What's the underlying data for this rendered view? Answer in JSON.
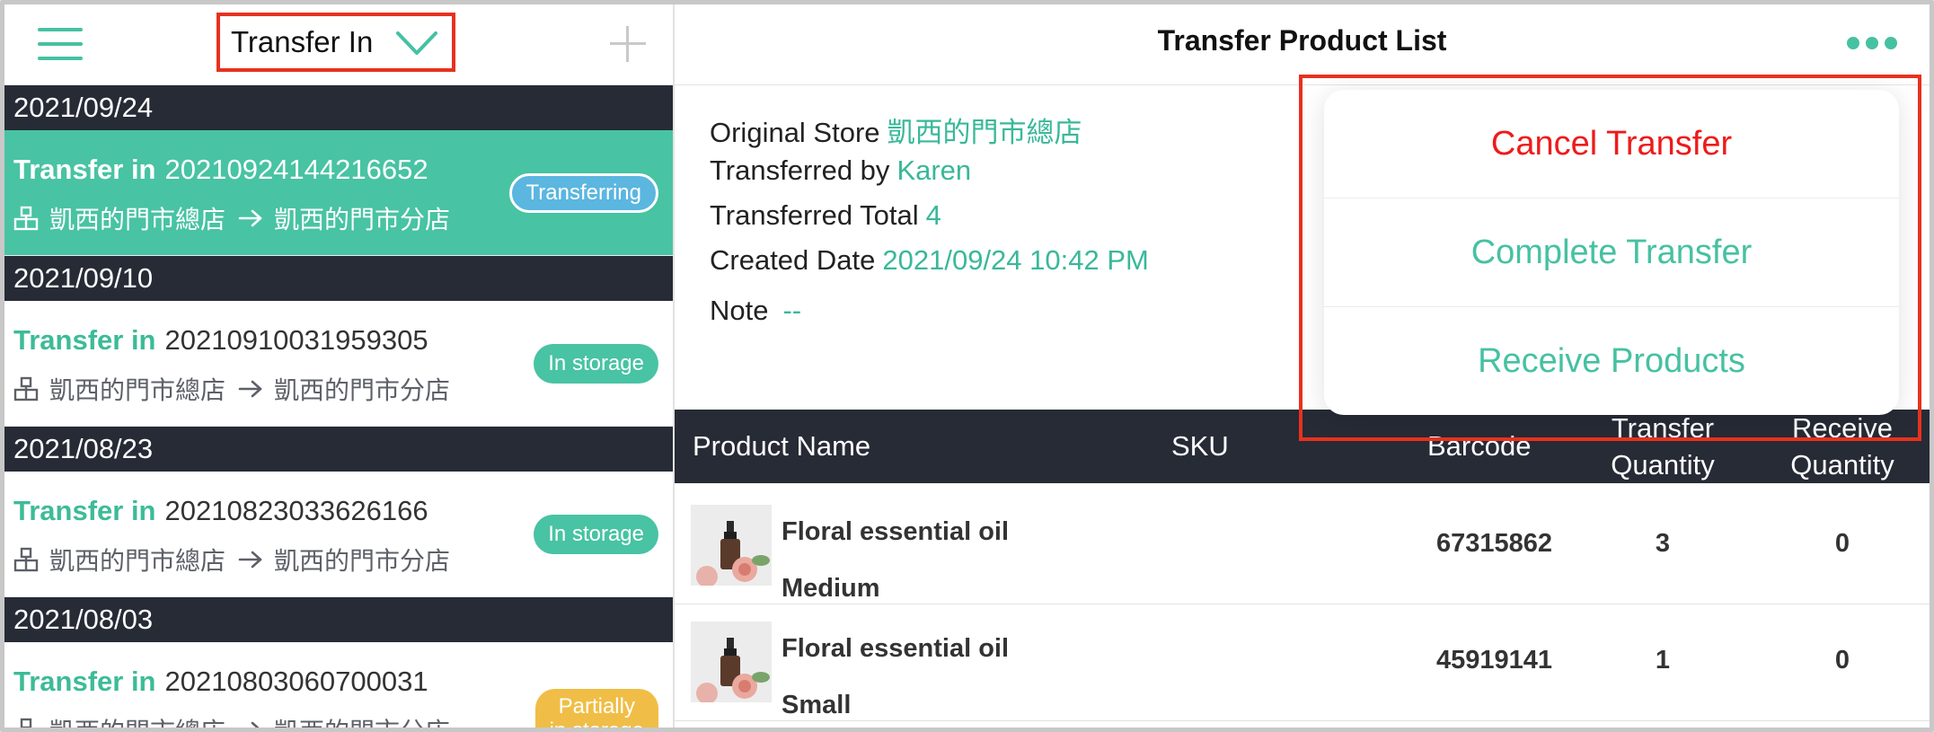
{
  "left": {
    "title": "Transfer In",
    "groups": [
      {
        "date": "2021/09/24",
        "items": [
          {
            "type_label": "Transfer in",
            "number": "20210924144216652",
            "from": "凱西的門市總店",
            "to": "凱西的門市分店",
            "status": "Transferring",
            "status_style": "transferring",
            "active": true
          }
        ]
      },
      {
        "date": "2021/09/10",
        "items": [
          {
            "type_label": "Transfer in",
            "number": "20210910031959305",
            "from": "凱西的門市總店",
            "to": "凱西的門市分店",
            "status": "In storage",
            "status_style": "storage",
            "active": false
          }
        ]
      },
      {
        "date": "2021/08/23",
        "items": [
          {
            "type_label": "Transfer in",
            "number": "20210823033626166",
            "from": "凱西的門市總店",
            "to": "凱西的門市分店",
            "status": "In storage",
            "status_style": "storage",
            "active": false
          }
        ]
      },
      {
        "date": "2021/08/03",
        "items": [
          {
            "type_label": "Transfer in",
            "number": "20210803060700031",
            "from": "凱西的門市總店",
            "to": "凱西的門市分店",
            "status_line1": "Partially",
            "status_line2": "in storage",
            "status_style": "partial",
            "active": false
          }
        ]
      }
    ]
  },
  "right": {
    "title": "Transfer Product List",
    "info": {
      "original_store_label": "Original Store",
      "original_store": "凱西的門市總店",
      "transferred_by_label": "Transferred by",
      "transferred_by": "Karen",
      "transferred_total_label": "Transferred Total",
      "transferred_total": "4",
      "created_date_label": "Created Date",
      "created_date": "2021/09/24 10:42 PM",
      "note_label": "Note",
      "note": "--"
    },
    "table": {
      "headers": {
        "name": "Product Name",
        "sku": "SKU",
        "barcode": "Barcode",
        "transfer_qty_line1": "Transfer",
        "transfer_qty_line2": "Quantity",
        "receive_qty_line1": "Receive",
        "receive_qty_line2": "Quantity"
      },
      "rows": [
        {
          "name": "Floral essential oil",
          "variant": "Medium",
          "sku": "",
          "barcode": "67315862",
          "transfer_qty": "3",
          "receive_qty": "0"
        },
        {
          "name": "Floral essential oil",
          "variant": "Small",
          "sku": "",
          "barcode": "45919141",
          "transfer_qty": "1",
          "receive_qty": "0"
        }
      ]
    },
    "menu": {
      "cancel": "Cancel Transfer",
      "complete": "Complete Transfer",
      "receive": "Receive Products"
    }
  },
  "colors": {
    "accent": "#46c1a2",
    "dark_header": "#262b36",
    "danger": "#ee1b1b",
    "highlight_outline": "#e8311e",
    "badge_transferring": "#5bb6e0",
    "badge_partial": "#f0be46"
  },
  "icons": {
    "menu": "hamburger-icon",
    "dropdown": "chevron-down-icon",
    "add": "plus-icon",
    "store": "store-icon",
    "arrow": "arrow-right-icon",
    "more": "more-dots-icon"
  }
}
